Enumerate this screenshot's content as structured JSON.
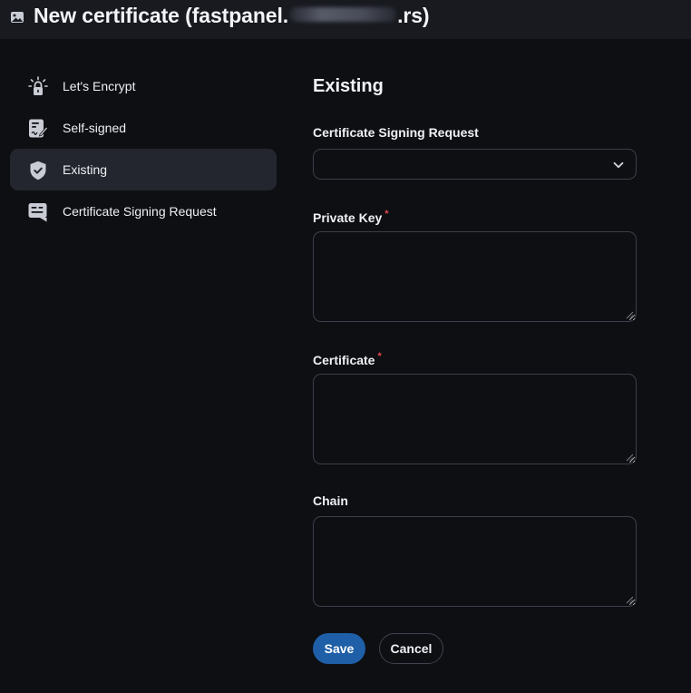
{
  "header": {
    "title_prefix": "New certificate (fastpanel.",
    "title_suffix": ".rs)",
    "icon": "image-icon"
  },
  "sidebar": {
    "items": [
      {
        "label": "Let's Encrypt",
        "icon": "lock-sparkle-icon",
        "active": false
      },
      {
        "label": "Self-signed",
        "icon": "signed-document-icon",
        "active": false
      },
      {
        "label": "Existing",
        "icon": "shield-check-icon",
        "active": true
      },
      {
        "label": "Certificate Signing Request",
        "icon": "request-message-icon",
        "active": false
      }
    ]
  },
  "form": {
    "section_title": "Existing",
    "csr_label": "Certificate Signing Request",
    "csr_value": "",
    "private_key_label": "Private Key",
    "private_key_value": "",
    "certificate_label": "Certificate",
    "certificate_value": "",
    "chain_label": "Chain",
    "chain_value": "",
    "required_mark": "*"
  },
  "actions": {
    "save_label": "Save",
    "cancel_label": "Cancel"
  },
  "colors": {
    "background": "#0e0f13",
    "header": "#181a20",
    "active_item": "#23262e",
    "primary": "#1f5fa8",
    "required": "#e5484d"
  }
}
